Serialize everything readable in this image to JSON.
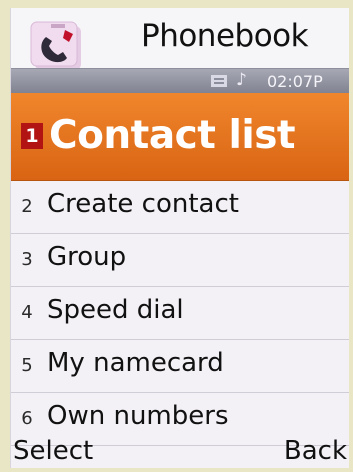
{
  "header": {
    "title": "Phonebook",
    "app_icon": "phone-handset-icon"
  },
  "status_bar": {
    "icons": [
      "message-icon",
      "music-note-icon"
    ],
    "note_glyph": "♪",
    "time": "02:07P"
  },
  "menu": {
    "items": [
      {
        "number": "1",
        "label": "Contact list",
        "selected": true
      },
      {
        "number": "2",
        "label": "Create contact",
        "selected": false
      },
      {
        "number": "3",
        "label": "Group",
        "selected": false
      },
      {
        "number": "4",
        "label": "Speed dial",
        "selected": false
      },
      {
        "number": "5",
        "label": "My namecard",
        "selected": false
      },
      {
        "number": "6",
        "label": "Own numbers",
        "selected": false
      }
    ]
  },
  "softkeys": {
    "left": "Select",
    "right": "Back"
  },
  "colors": {
    "highlight": "#e8741f",
    "number_badge": "#b21414",
    "status_bar": "#8f909e"
  }
}
